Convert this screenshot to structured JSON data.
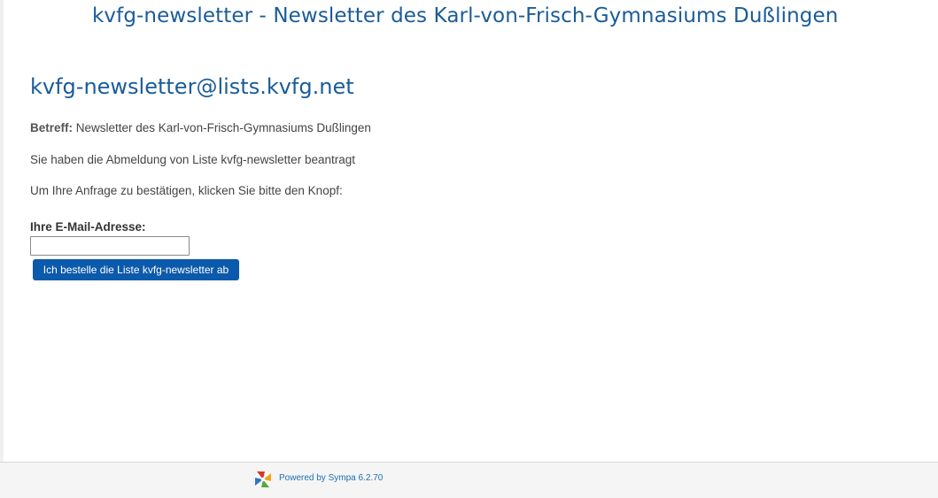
{
  "header": {
    "title": "kvfg-newsletter - Newsletter des Karl-von-Frisch-Gymnasiums Dußlingen"
  },
  "main": {
    "list_address": "kvfg-newsletter@lists.kvfg.net",
    "subject_label": "Betreff:",
    "subject_value": " Newsletter des Karl-von-Frisch-Gymnasiums Dußlingen",
    "info_text": "Sie haben die Abmeldung von Liste kvfg-newsletter beantragt",
    "confirm_text": "Um Ihre Anfrage zu bestätigen, klicken Sie bitte den Knopf:",
    "form": {
      "email_label": "Ihre E-Mail-Adresse:",
      "email_value": "",
      "button_label": "Ich bestelle die Liste kvfg-newsletter ab"
    }
  },
  "footer": {
    "powered_by": "Powered by Sympa 6.2.70",
    "icon": "sympa-logo-icon"
  },
  "colors": {
    "heading": "#1a5c99",
    "button": "#0b5aab",
    "link": "#1a6fb0"
  }
}
